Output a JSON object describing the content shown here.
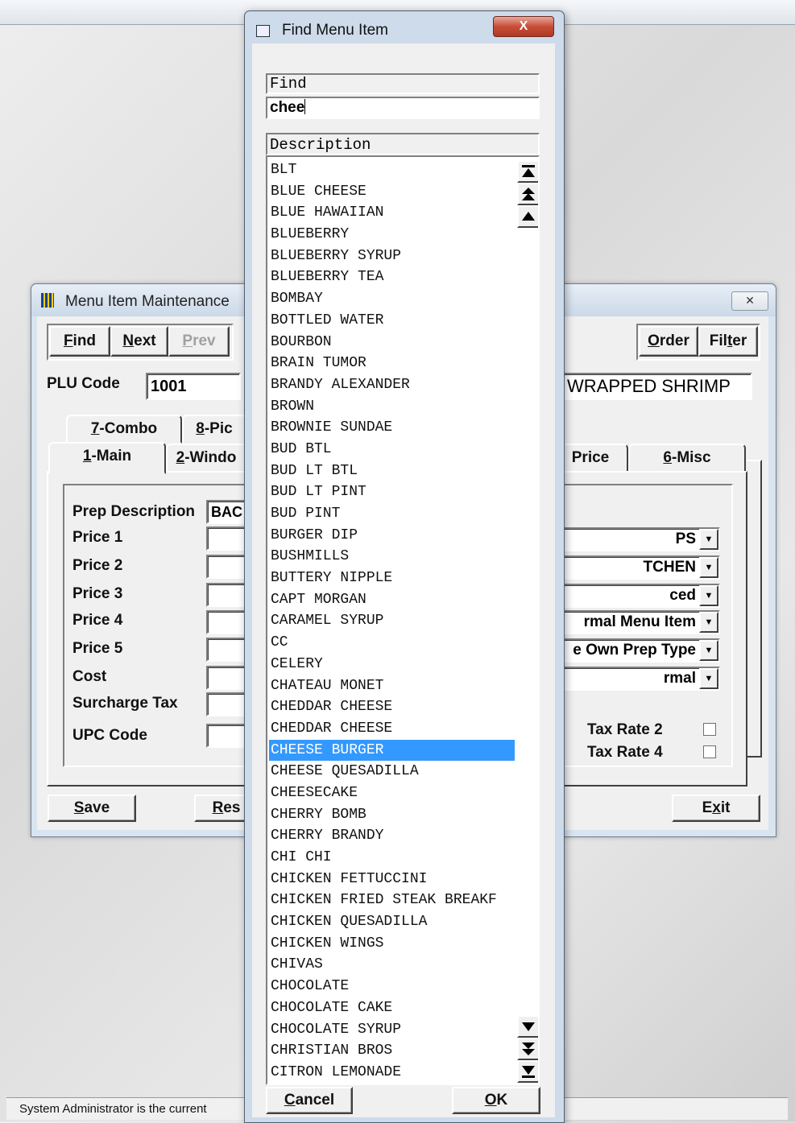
{
  "main_window": {
    "title": "Menu Item Maintenance",
    "close_label": "✕",
    "buttons": {
      "find": {
        "accel": "F",
        "rest": "ind"
      },
      "next": {
        "accel": "N",
        "rest": "ext"
      },
      "prev": {
        "accel": "P",
        "rest": "rev"
      },
      "order": {
        "accel": "O",
        "rest": "rder"
      },
      "filter": {
        "pre": "Fil",
        "accel": "t",
        "rest": "er"
      },
      "save": {
        "accel": "S",
        "rest": "ave"
      },
      "reset": {
        "accel": "R",
        "rest": "es"
      },
      "exit": {
        "pre": "E",
        "accel": "x",
        "rest": "it"
      }
    },
    "plu_label": "PLU Code",
    "plu_value": "1001",
    "description_value": "WRAPPED SHRIMP",
    "tabs_back": [
      {
        "accel": "7",
        "rest": "-Combo"
      },
      {
        "accel": "8",
        "rest": "-Pic"
      }
    ],
    "tabs_front": [
      {
        "accel": "1",
        "rest": "-Main"
      },
      {
        "accel": "2",
        "rest": "-Windo"
      },
      {
        "accel": "",
        "rest": "Price"
      },
      {
        "accel": "6",
        "rest": "-Misc"
      }
    ],
    "fields": [
      {
        "label": "Prep Description",
        "value": "BAC"
      },
      {
        "label": "Price 1",
        "value": ""
      },
      {
        "label": "Price 2",
        "value": ""
      },
      {
        "label": "Price 3",
        "value": ""
      },
      {
        "label": "Price 4",
        "value": ""
      },
      {
        "label": "Price 5",
        "value": ""
      },
      {
        "label": "Cost",
        "value": ""
      },
      {
        "label": "Surcharge Tax",
        "value": ""
      },
      {
        "label": "UPC Code",
        "value": ""
      }
    ],
    "combos": [
      "PS",
      "TCHEN",
      "ced",
      "rmal Menu Item",
      "e Own Prep Type",
      "rmal"
    ],
    "tax_rates": [
      {
        "label": "Tax Rate 2",
        "checked": false
      },
      {
        "label": "Tax Rate 4",
        "checked": false
      }
    ]
  },
  "find_dialog": {
    "title": "Find Menu Item",
    "close_label": "X",
    "find_header": "Find",
    "find_value": "chee",
    "list_header": "Description",
    "selected_index": 27,
    "items": [
      "BLT",
      "BLUE CHEESE",
      "BLUE HAWAIIAN",
      "BLUEBERRY",
      "BLUEBERRY SYRUP",
      "BLUEBERRY TEA",
      "BOMBAY",
      "BOTTLED WATER",
      "BOURBON",
      "BRAIN TUMOR",
      "BRANDY ALEXANDER",
      "BROWN",
      "BROWNIE SUNDAE",
      "BUD BTL",
      "BUD LT BTL",
      "BUD LT PINT",
      "BUD PINT",
      "BURGER DIP",
      "BUSHMILLS",
      "BUTTERY NIPPLE",
      "CAPT MORGAN",
      "CARAMEL SYRUP",
      "CC",
      "CELERY",
      "CHATEAU MONET",
      "CHEDDAR CHEESE",
      "CHEDDAR CHEESE",
      "CHEESE BURGER",
      "CHEESE QUESADILLA",
      "CHEESECAKE",
      "CHERRY BOMB",
      "CHERRY BRANDY",
      "CHI CHI",
      "CHICKEN FETTUCCINI",
      "CHICKEN FRIED STEAK BREAKF",
      "CHICKEN QUESADILLA",
      "CHICKEN WINGS",
      "CHIVAS",
      "CHOCOLATE",
      "CHOCOLATE CAKE",
      "CHOCOLATE SYRUP",
      "CHRISTIAN BROS",
      "CITRON LEMONADE"
    ],
    "cancel": {
      "accel": "C",
      "rest": "ancel"
    },
    "ok": {
      "accel": "O",
      "rest": "K"
    }
  },
  "status_bar": {
    "text": "System Administrator is the current"
  }
}
